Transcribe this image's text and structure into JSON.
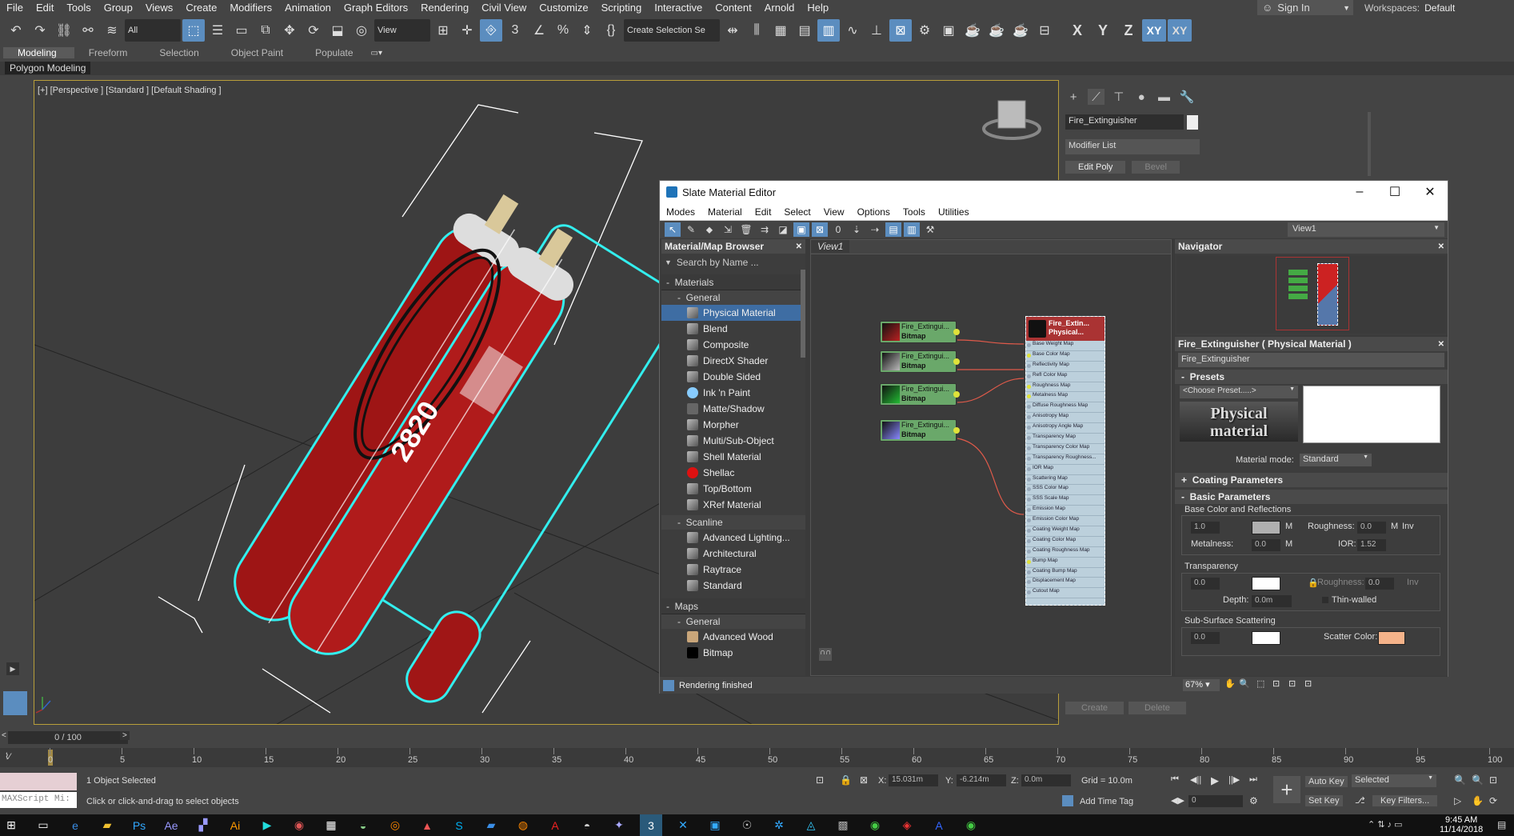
{
  "menu": [
    "File",
    "Edit",
    "Tools",
    "Group",
    "Views",
    "Create",
    "Modifiers",
    "Animation",
    "Graph Editors",
    "Rendering",
    "Civil View",
    "Customize",
    "Scripting",
    "Interactive",
    "Content",
    "Arnold",
    "Help"
  ],
  "signin": "Sign In",
  "workspaces_label": "Workspaces:",
  "workspaces_value": "Default",
  "toolbar": {
    "filter": "All",
    "view": "View",
    "selection_set": "Create Selection Se",
    "axes": [
      "X",
      "Y",
      "Z",
      "XY",
      "XY"
    ]
  },
  "ribbon_tabs": [
    "Modeling",
    "Freeform",
    "Selection",
    "Object Paint",
    "Populate"
  ],
  "subribbon": "Polygon Modeling",
  "viewport_label": "[+] [Perspective ] [Standard ] [Default Shading ]",
  "model_text": "2820",
  "command_panel": {
    "object_name": "Fire_Extinguisher",
    "modifier_list": "Modifier List",
    "buttons": [
      "Edit Poly",
      "Bevel"
    ],
    "bottom_buttons": [
      "Create",
      "Delete"
    ]
  },
  "slate": {
    "title": "Slate Material Editor",
    "menu": [
      "Modes",
      "Material",
      "Edit",
      "Select",
      "View",
      "Options",
      "Tools",
      "Utilities"
    ],
    "view_select": "View1",
    "browser_title": "Material/Map Browser",
    "search_placeholder": "Search by Name ...",
    "materials_label": "Materials",
    "general_label": "General",
    "general_items": [
      "Physical Material",
      "Blend",
      "Composite",
      "DirectX Shader",
      "Double Sided",
      "Ink 'n Paint",
      "Matte/Shadow",
      "Morpher",
      "Multi/Sub-Object",
      "Shell Material",
      "Shellac",
      "Top/Bottom",
      "XRef Material"
    ],
    "scanline_label": "Scanline",
    "scanline_items": [
      "Advanced Lighting...",
      "Architectural",
      "Raytrace",
      "Standard"
    ],
    "maps_label": "Maps",
    "maps_general_label": "General",
    "maps_items": [
      "Advanced Wood",
      "Bitmap"
    ],
    "view_tab": "View1",
    "nodes": [
      {
        "title": "Fire_Extingui...",
        "type": "Bitmap"
      },
      {
        "title": "Fire_Extingui...",
        "type": "Bitmap"
      },
      {
        "title": "Fire_Extingui...",
        "type": "Bitmap"
      },
      {
        "title": "Fire_Extingui...",
        "type": "Bitmap"
      }
    ],
    "material_node": {
      "title": "Fire_Extin...",
      "subtitle": "Physical...",
      "slots": [
        "Base Weight Map",
        "Base Color Map",
        "Reflectivity Map",
        "Refl Color Map",
        "Roughness Map",
        "Metalness Map",
        "Diffuse Roughness Map",
        "Anisotropy Map",
        "Anisotropy Angle Map",
        "Transparency Map",
        "Transparency Color Map",
        "Transparency Roughness...",
        "IOR Map",
        "Scattering Map",
        "SSS Color Map",
        "SSS Scale Map",
        "Emission Map",
        "Emission Color Map",
        "Coating Weight Map",
        "Coating Color Map",
        "Coating Roughness Map",
        "Bump Map",
        "Coating Bump Map",
        "Displacement Map",
        "Cutout Map"
      ]
    },
    "navigator_title": "Navigator",
    "props_title": "Fire_Extinguisher  ( Physical Material )",
    "props_name": "Fire_Extinguisher",
    "presets_label": "Presets",
    "preset_select": "<Choose Preset.....>",
    "preset_logo": "Physical material",
    "material_mode_label": "Material mode:",
    "material_mode_value": "Standard",
    "coating_label": "Coating Parameters",
    "basic_label": "Basic Parameters",
    "base_color_label": "Base Color and Reflections",
    "base_weight": "1.0",
    "roughness_label": "Roughness:",
    "roughness_value": "0.0",
    "inv": "Inv",
    "metalness_label": "Metalness:",
    "metalness_value": "0.0",
    "ior_label": "IOR:",
    "ior_value": "1.52",
    "m": "M",
    "transparency_label": "Transparency",
    "transparency_value": "0.0",
    "tr_roughness_value": "0.0",
    "depth_label": "Depth:",
    "depth_value": "0.0m",
    "thin_walled": "Thin-walled",
    "sss_label": "Sub-Surface Scattering",
    "sss_value": "0.0",
    "scatter_label": "Scatter Color:",
    "status": "Rendering finished",
    "zoom": "67%"
  },
  "timeline": {
    "frame": "0 / 100"
  },
  "ruler_ticks": [
    "0",
    "5",
    "10",
    "15",
    "20",
    "25",
    "30",
    "35",
    "40",
    "45",
    "50",
    "55",
    "60",
    "65",
    "70",
    "75",
    "80",
    "85",
    "90",
    "95",
    "100"
  ],
  "status": {
    "maxscript": "MAXScript Mi:",
    "selected": "1 Object Selected",
    "hint": "Click or click-and-drag to select objects",
    "x_label": "X:",
    "x_value": "15.031m",
    "y_label": "Y:",
    "y_value": "-6.214m",
    "z_label": "Z:",
    "z_value": "0.0m",
    "grid": "Grid = 10.0m",
    "add_time_tag": "Add Time Tag",
    "auto_key": "Auto Key",
    "set_key": "Set Key",
    "selected_dd": "Selected",
    "key_filters": "Key Filters...",
    "frame_field": "0"
  },
  "clock": {
    "time": "9:45 AM",
    "date": "11/14/2018"
  },
  "colors": {
    "accent": "#5b8dbf",
    "node_green": "#6aa86a",
    "material_head": "#aa3333",
    "scatter": "#f5b38a"
  }
}
